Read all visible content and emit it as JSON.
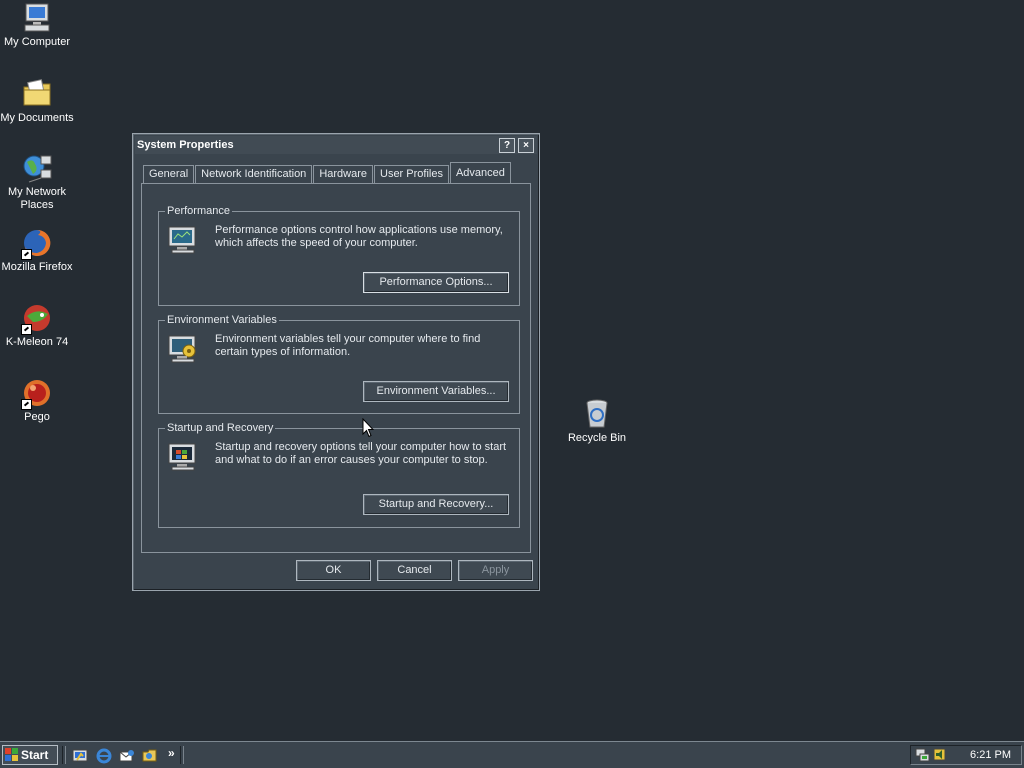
{
  "desktop": {
    "icons": [
      {
        "label": "My Computer"
      },
      {
        "label": "My Documents"
      },
      {
        "label": "My Network Places"
      },
      {
        "label": "Mozilla Firefox"
      },
      {
        "label": "K-Meleon 74"
      },
      {
        "label": "Pego"
      },
      {
        "label": "Recycle Bin"
      }
    ]
  },
  "dialog": {
    "title": "System Properties",
    "help_glyph": "?",
    "close_glyph": "×",
    "tabs": [
      "General",
      "Network Identification",
      "Hardware",
      "User Profiles",
      "Advanced"
    ],
    "active_tab": "Advanced",
    "groups": {
      "performance": {
        "title": "Performance",
        "text": "Performance options control how applications use memory, which affects the speed of your computer.",
        "button": "Performance Options..."
      },
      "environment": {
        "title": "Environment Variables",
        "text": "Environment variables tell your computer where to find certain types of information.",
        "button": "Environment Variables..."
      },
      "startup": {
        "title": "Startup and Recovery",
        "text": "Startup and recovery options tell your computer how to start and what to do if an error causes your computer to stop.",
        "button": "Startup and Recovery..."
      }
    },
    "buttons": {
      "ok": "OK",
      "cancel": "Cancel",
      "apply": "Apply"
    }
  },
  "taskbar": {
    "start_label": "Start",
    "more_glyph": "»",
    "clock": "6:21 PM"
  },
  "colors": {
    "desktop": "#252c33",
    "window": "#3a444d",
    "text": "#e6eaee"
  }
}
